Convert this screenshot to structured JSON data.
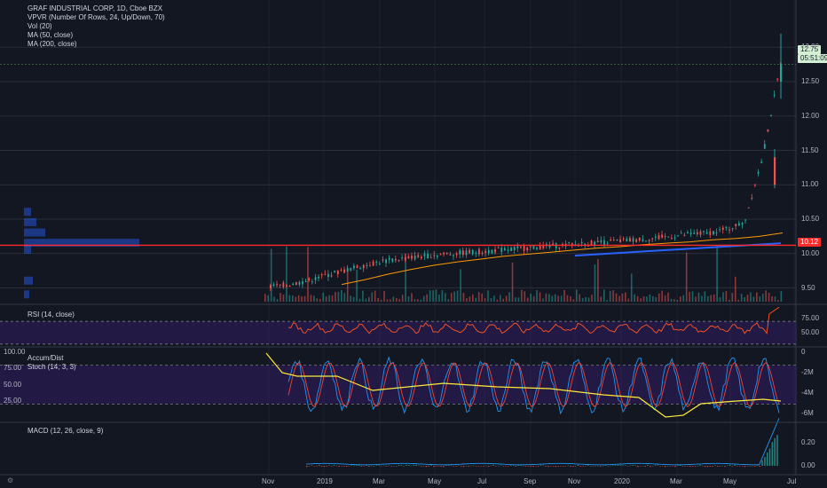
{
  "header": {
    "symbol_line": "GRAF INDUSTRIAL CORP, 1D, Cboe BZX",
    "indicators": [
      "VPVR (Number Of Rows, 24, Up/Down, 70)",
      "Vol (20)",
      "MA (50, close)",
      "MA (200, close)"
    ]
  },
  "price_badges": {
    "last": "12.75",
    "countdown": "05:51:09",
    "line_level": "10.12"
  },
  "panes": {
    "rsi_label": "RSI (14, close)",
    "accum_label": "Accum/Dist",
    "stoch_label": "Stoch (14, 3, 3)",
    "macd_label": "MACD (12, 26, close, 9)"
  },
  "colors": {
    "background": "#131722",
    "up": "#26a69a",
    "down": "#ef5350",
    "ma50": "#ff9800",
    "ma200": "#2962ff",
    "hline": "#ff2a2a",
    "rsi": "#ff5722",
    "accum": "#ffeb3b",
    "stoch_k": "#2196f3",
    "stoch_d": "#f44336",
    "band": "#311b63",
    "last_badge_bg": "#d4f0d4"
  },
  "chart_data": [
    {
      "type": "candlestick",
      "title": "GRAF INDUSTRIAL CORP, 1D, Cboe BZX",
      "x_labels": [
        "Nov",
        "2019",
        "Mar",
        "May",
        "Jul",
        "Sep",
        "Nov",
        "2020",
        "Mar",
        "May",
        "Jul"
      ],
      "y_ticks": [
        "13.00",
        "12.50",
        "12.00",
        "11.50",
        "11.00",
        "10.50",
        "10.00",
        "9.50"
      ],
      "ylim": [
        9.3,
        13.3
      ],
      "series": {
        "close_estimated": [
          9.52,
          9.55,
          9.6,
          9.68,
          9.75,
          9.82,
          9.88,
          9.92,
          9.95,
          9.98,
          10.0,
          10.02,
          10.04,
          10.06,
          10.08,
          10.1,
          10.12,
          10.14,
          10.16,
          10.18,
          10.2,
          10.22,
          10.25,
          10.28,
          10.3,
          10.35,
          10.45,
          11.4,
          12.75
        ],
        "ma50": [
          9.55,
          9.62,
          9.7,
          9.77,
          9.83,
          9.88,
          9.92,
          9.96,
          9.99,
          10.02,
          10.05,
          10.08,
          10.1,
          10.13,
          10.15,
          10.17,
          10.2,
          10.22,
          10.25,
          10.3
        ],
        "ma200": [
          9.97,
          10.0,
          10.03,
          10.06,
          10.09,
          10.12,
          10.15
        ]
      },
      "horizontal_line": 10.12,
      "last_price": 12.75
    },
    {
      "type": "line",
      "title": "RSI (14, close)",
      "y_ticks": [
        "75.00",
        "50.00"
      ],
      "ylim": [
        25,
        100
      ],
      "bands": [
        70,
        30
      ]
    },
    {
      "type": "line",
      "title": "Accum/Dist, Stoch (14, 3, 3)",
      "y_ticks_left": [
        "100.00",
        "75.00",
        "50.00",
        "25.00"
      ],
      "y_ticks_right": [
        "0",
        "-2M",
        "-4M",
        "-6M"
      ]
    },
    {
      "type": "bar",
      "title": "MACD (12, 26, close, 9)",
      "y_ticks": [
        "0.20",
        "0.00"
      ]
    }
  ]
}
